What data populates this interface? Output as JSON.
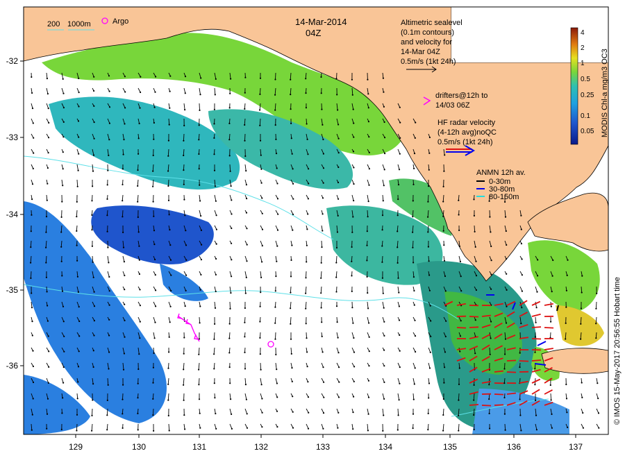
{
  "map": {
    "title_date": "14-Mar-2014",
    "title_time": "04Z",
    "legend_depth_200": "200",
    "legend_depth_1000": "1000m",
    "legend_argo": "Argo",
    "altimetry_lines": [
      "Altimetric sealevel",
      "(0.1m contours)",
      "and velocity for",
      "14-Mar 04Z",
      "0.5m/s (1kt 24h)"
    ],
    "drifters_lines": [
      "drifters@12h to",
      "14/03 06Z"
    ],
    "hf_radar_lines": [
      "HF radar velocity",
      "(4-12h avg)noQC",
      "0.5m/s (1kt 24h)"
    ],
    "anmn_title": "ANMN 12h av.",
    "anmn_entries": [
      {
        "label": "0-30m",
        "color": "#000000"
      },
      {
        "label": "30-80m",
        "color": "#0000ee"
      },
      {
        "label": "80-150m",
        "color": "#22dddd"
      }
    ],
    "x_ticks": [
      "129",
      "130",
      "131",
      "132",
      "133",
      "134",
      "135",
      "136",
      "137"
    ],
    "y_ticks": [
      "-32",
      "-33",
      "-34",
      "-35",
      "-36"
    ],
    "colorbar_label": "MODIS Chl-a mg/m3 OC3",
    "colorbar_ticks": [
      "4",
      "2",
      "1",
      "0.5",
      "0.25",
      "0.1",
      "0.05"
    ],
    "credit": "© IMOS 15-May-2017 20:56:55 Hobart time"
  },
  "colors": {
    "land": "#f9c597",
    "chl_high": "#78d63a",
    "chl_mid": "#2fb7bd",
    "chl_low": "#2a7fe0",
    "chl_vlow": "#1f55cc",
    "isobath": "#5de0e8",
    "drifter": "#ff00ff",
    "hf_radar": "#dd1111"
  }
}
